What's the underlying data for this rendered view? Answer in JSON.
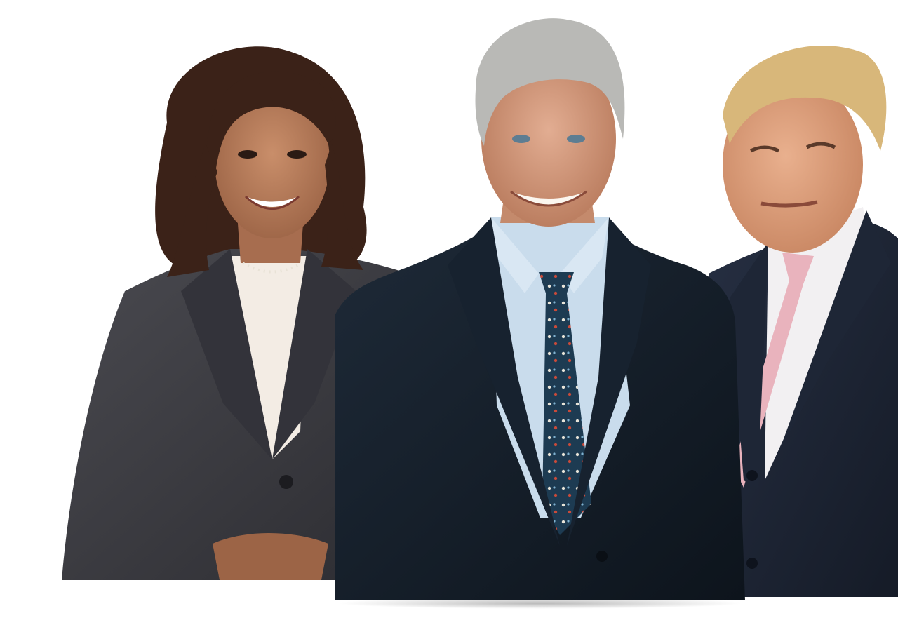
{
  "scene": {
    "description_label": "",
    "background_color": "#ffffff",
    "figures": [
      {
        "id": "left",
        "suit_color": "#3a3a3e",
        "blouse_color": "#f3ece4",
        "hair_color": "#3b2218",
        "skin_color": "#b57a58"
      },
      {
        "id": "center",
        "suit_color": "#15202c",
        "shirt_color": "#c9dcec",
        "tie_color": "#1d3b52",
        "hair_color": "#b9b9b6",
        "skin_color": "#d69f84"
      },
      {
        "id": "right",
        "suit_color": "#1c2433",
        "shirt_color": "#f2f0f2",
        "tie_color": "#e9b3bd",
        "hair_color": "#d8b77a",
        "skin_color": "#e0a07e"
      }
    ]
  }
}
